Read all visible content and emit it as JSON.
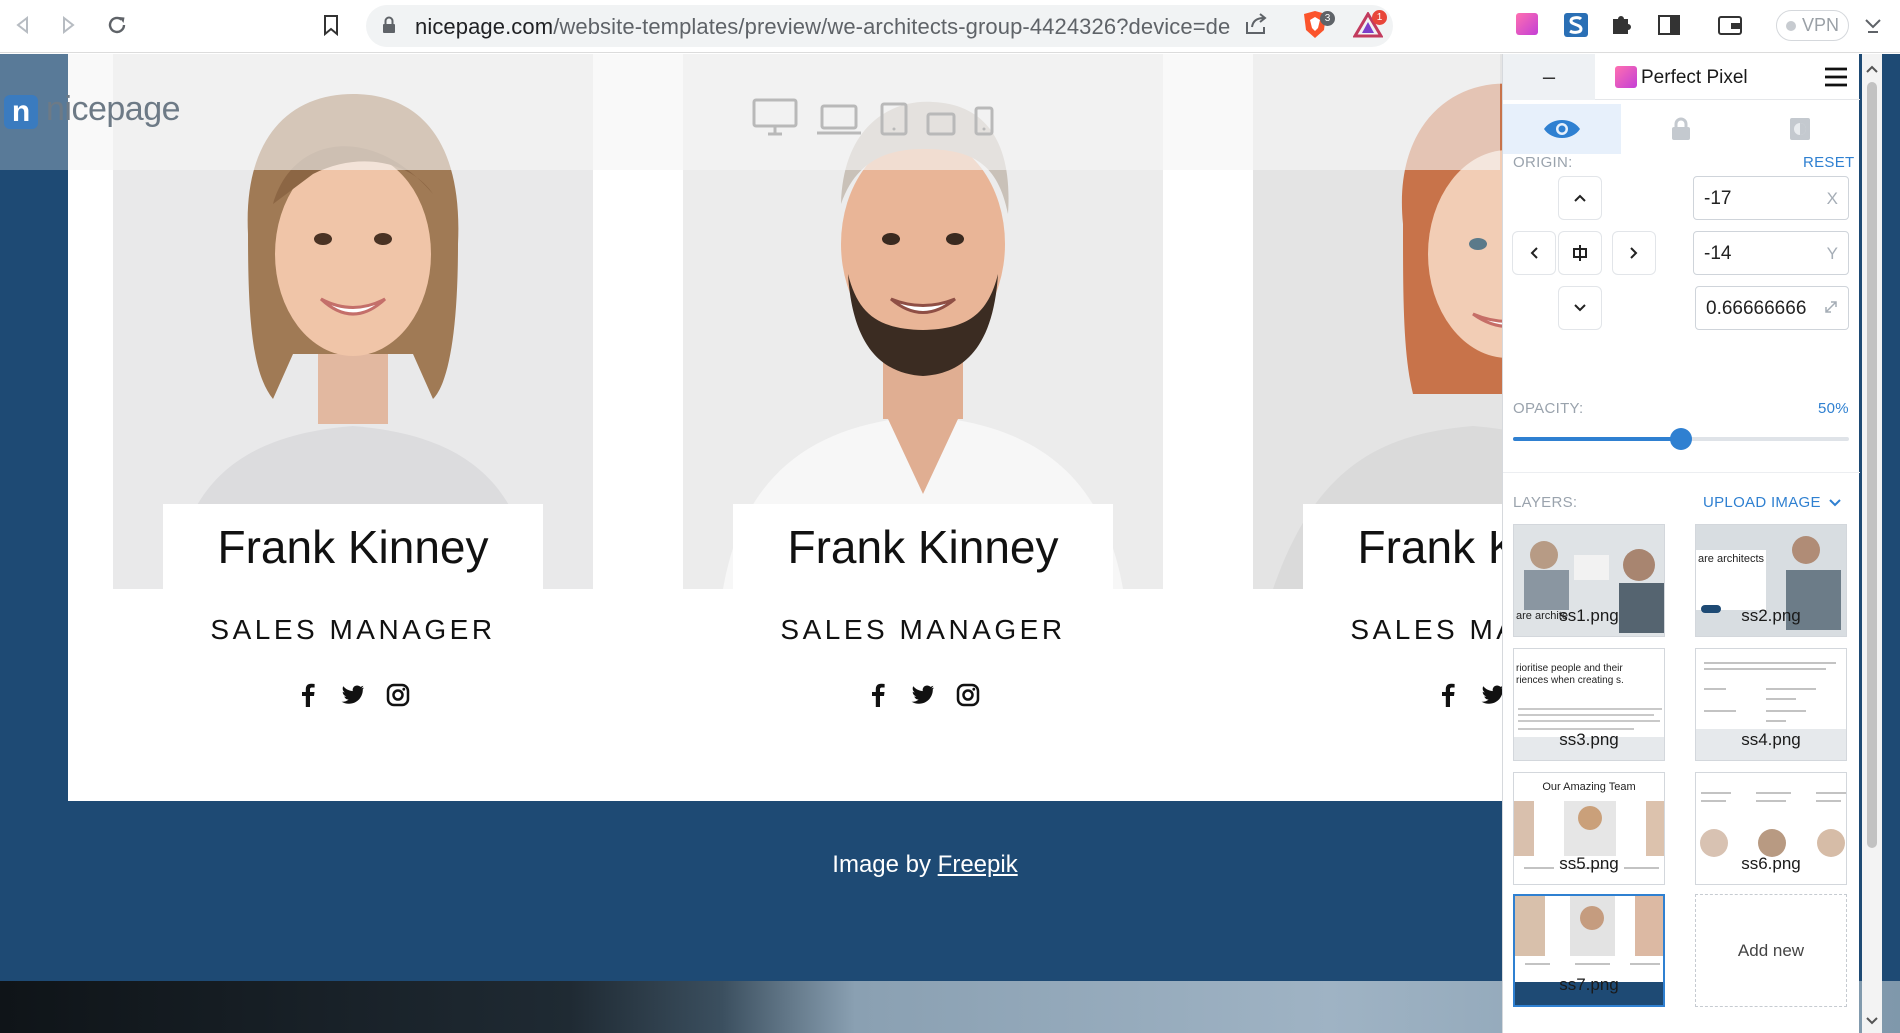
{
  "browser": {
    "url_host": "nicepage.com",
    "url_path": "/website-templates/preview/we-architects-group-4424326?device=desk...",
    "brave_badge": "3",
    "alert_badge": "1",
    "vpn_label": "VPN"
  },
  "site": {
    "logo_text": "nicepage",
    "team": [
      {
        "name": "Frank Kinney",
        "role": "SALES MANAGER"
      },
      {
        "name": "Frank Kinney",
        "role": "SALES MANAGER"
      },
      {
        "name": "Frank Kinney",
        "role": "SALES MANAGER"
      }
    ],
    "credit_prefix": "Image by",
    "credit_link": "Freepik"
  },
  "perfect_pixel": {
    "title": "Perfect Pixel",
    "minimize_label": "–",
    "origin_label": "ORIGIN:",
    "reset_label": "RESET",
    "x_value": "-17",
    "x_unit": "X",
    "y_value": "-14",
    "y_unit": "Y",
    "scale_value": "0.66666666",
    "opacity_label": "OPACITY:",
    "opacity_value": "50%",
    "opacity_fraction": 0.5,
    "layers_label": "LAYERS:",
    "upload_label": "UPLOAD IMAGE",
    "layers": [
      {
        "name": "ss1.png",
        "preview_text": "are archite"
      },
      {
        "name": "ss2.png",
        "preview_text": "are architects"
      },
      {
        "name": "ss3.png",
        "preview_text": "rioritise people and their riences when creating s."
      },
      {
        "name": "ss4.png",
        "preview_text": ""
      },
      {
        "name": "ss5.png",
        "preview_text": "Our Amazing Team"
      },
      {
        "name": "ss6.png",
        "preview_text": ""
      },
      {
        "name": "ss7.png",
        "preview_text": ""
      }
    ],
    "add_new_label": "Add new"
  },
  "colors": {
    "page_blue": "#1e4a74",
    "accent_blue": "#2f80d1"
  }
}
